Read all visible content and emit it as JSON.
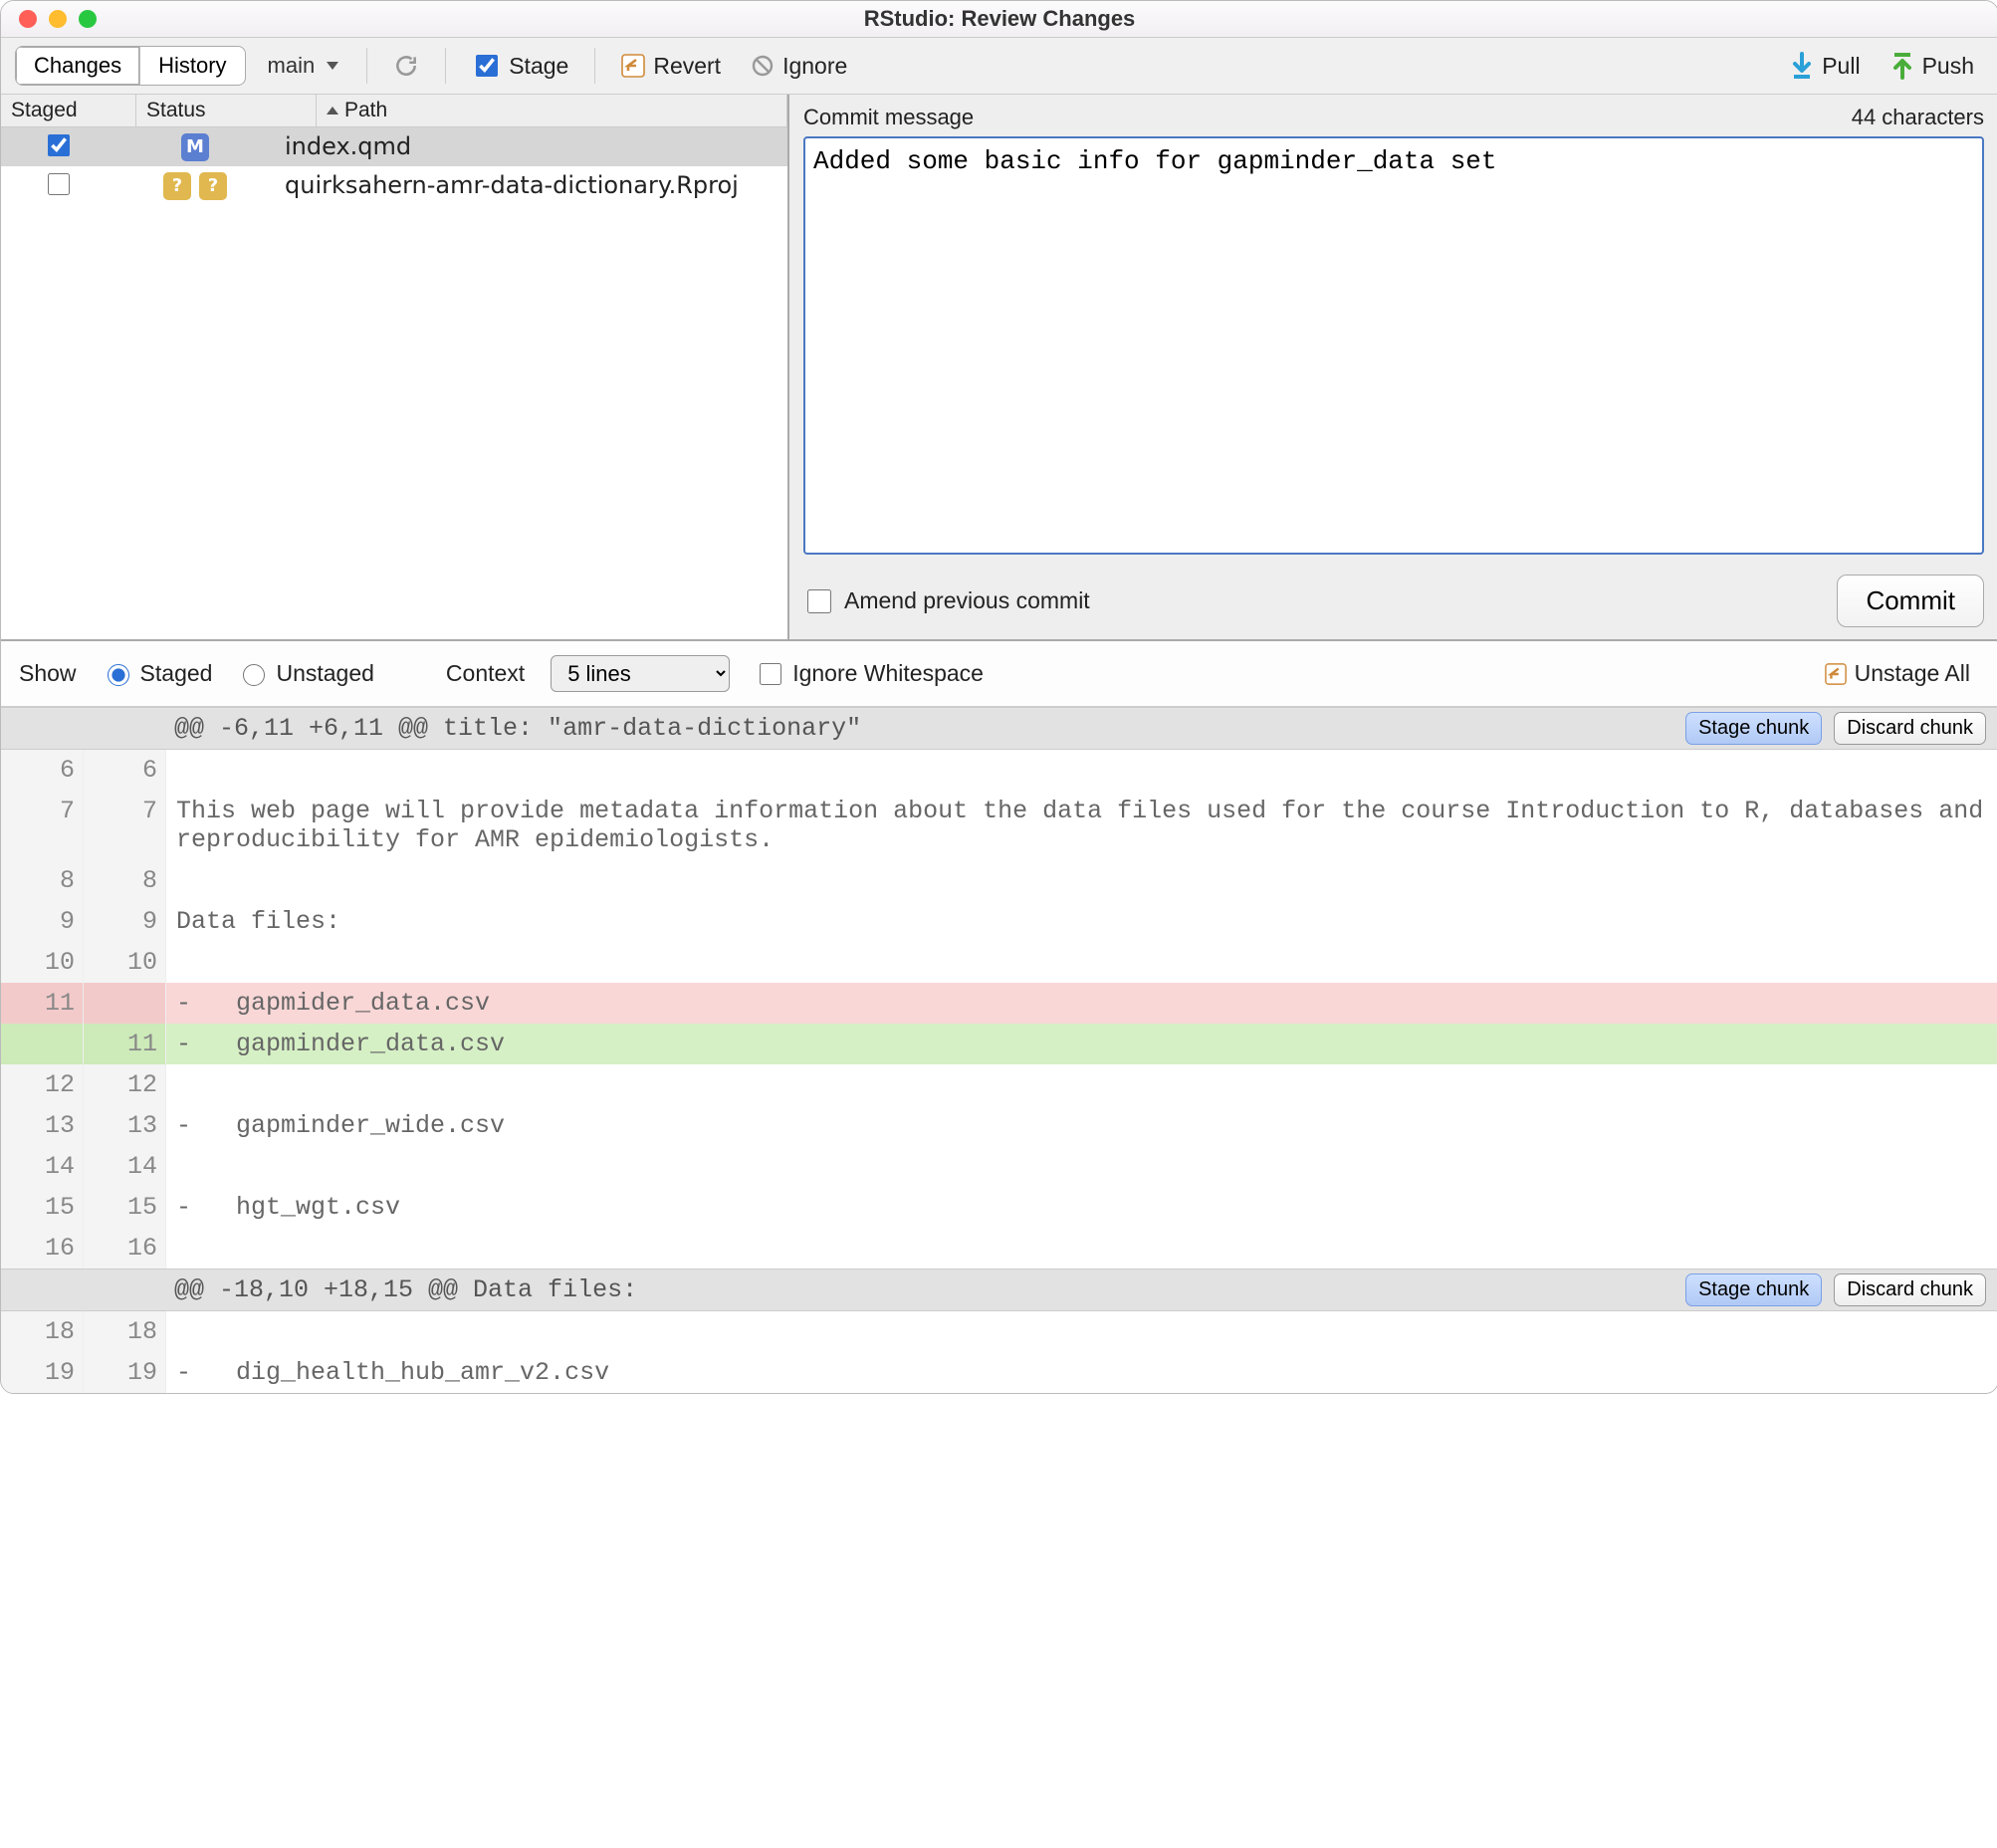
{
  "window": {
    "title": "RStudio: Review Changes"
  },
  "toolbar": {
    "tab_changes": "Changes",
    "tab_history": "History",
    "branch": "main",
    "stage": "Stage",
    "revert": "Revert",
    "ignore": "Ignore",
    "pull": "Pull",
    "push": "Push"
  },
  "filelist": {
    "headers": {
      "staged": "Staged",
      "status": "Status",
      "path": "Path"
    },
    "rows": [
      {
        "staged": true,
        "status": [
          "M"
        ],
        "path": "index.qmd",
        "selected": true
      },
      {
        "staged": false,
        "status": [
          "?",
          "?"
        ],
        "path": "quirksahern-amr-data-dictionary.Rproj",
        "selected": false
      }
    ]
  },
  "commit": {
    "label": "Commit message",
    "char_count": "44 characters",
    "message": "Added some basic info for gapminder_data set",
    "amend": "Amend previous commit",
    "button": "Commit"
  },
  "diff_opts": {
    "show": "Show",
    "staged": "Staged",
    "unstaged": "Unstaged",
    "context_label": "Context",
    "context_value": "5 lines",
    "ignore_ws": "Ignore Whitespace",
    "unstage_all": "Unstage All"
  },
  "chunk_btn": {
    "stage": "Stage chunk",
    "discard": "Discard chunk"
  },
  "diff": {
    "hunk1": "@@ -6,11 +6,11 @@ title: \"amr-data-dictionary\"",
    "hunk2": "@@ -18,10 +18,15 @@ Data files:",
    "lines1": [
      {
        "o": "6",
        "n": "6",
        "t": " ",
        "c": ""
      },
      {
        "o": "7",
        "n": "7",
        "t": " ",
        "c": "This web page will provide metadata information about the data files used for the course Introduction to R, databases and reproducibility for AMR epidemiologists."
      },
      {
        "o": "8",
        "n": "8",
        "t": " ",
        "c": ""
      },
      {
        "o": "9",
        "n": "9",
        "t": " ",
        "c": "Data files:"
      },
      {
        "o": "10",
        "n": "10",
        "t": " ",
        "c": ""
      },
      {
        "o": "11",
        "n": "",
        "t": "del",
        "c": "-   gapmider_data.csv"
      },
      {
        "o": "",
        "n": "11",
        "t": "add",
        "c": "-   gapminder_data.csv"
      },
      {
        "o": "12",
        "n": "12",
        "t": " ",
        "c": ""
      },
      {
        "o": "13",
        "n": "13",
        "t": " ",
        "c": "-   gapminder_wide.csv"
      },
      {
        "o": "14",
        "n": "14",
        "t": " ",
        "c": ""
      },
      {
        "o": "15",
        "n": "15",
        "t": " ",
        "c": "-   hgt_wgt.csv"
      },
      {
        "o": "16",
        "n": "16",
        "t": " ",
        "c": ""
      }
    ],
    "lines2": [
      {
        "o": "18",
        "n": "18",
        "t": " ",
        "c": ""
      },
      {
        "o": "19",
        "n": "19",
        "t": " ",
        "c": "-   dig_health_hub_amr_v2.csv"
      }
    ]
  }
}
